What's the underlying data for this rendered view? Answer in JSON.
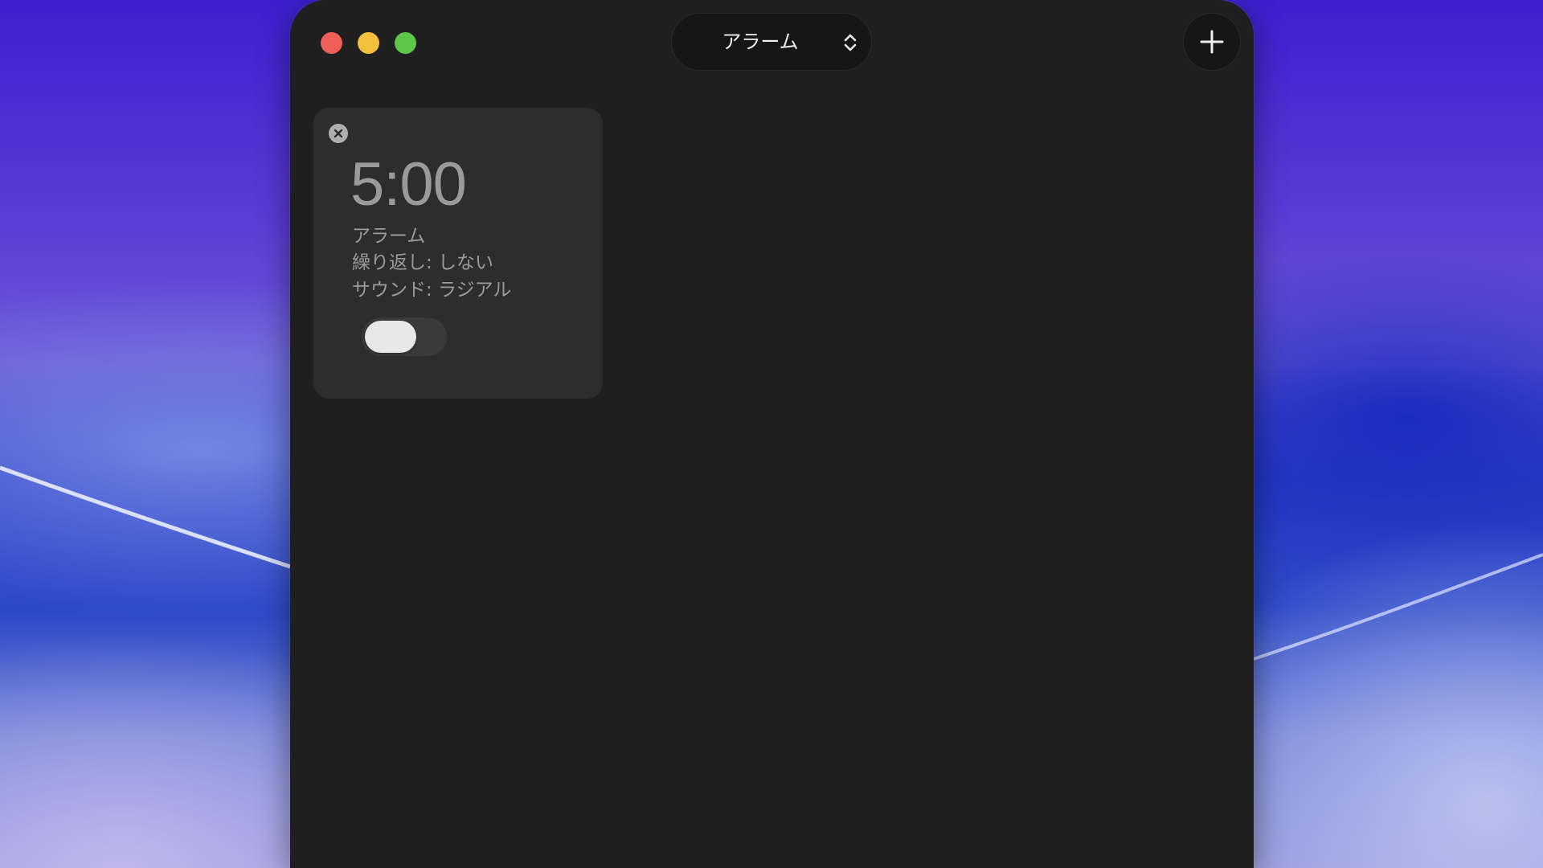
{
  "titlebar": {
    "view_picker_label": "アラーム"
  },
  "alarms": [
    {
      "time": "5:00",
      "label": "アラーム",
      "repeat": "繰り返し: しない",
      "sound": "サウンド: ラジアル",
      "enabled": false
    }
  ],
  "colors": {
    "window_bg": "#1f1f1f",
    "card_bg": "#2d2d2d",
    "close": "#ed5f57",
    "minimize": "#f4bf3a",
    "maximize": "#5ec648"
  }
}
